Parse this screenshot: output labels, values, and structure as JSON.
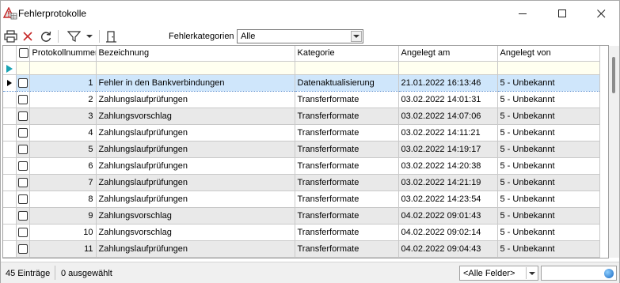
{
  "window": {
    "title": "Fehlerprotokolle",
    "minimize_glyph": "—",
    "maximize_glyph": "☐",
    "close_glyph": "✕"
  },
  "toolbar": {
    "filter_label": "Fehlerkategorien",
    "filter_value": "Alle",
    "icons": [
      "print-icon",
      "delete-icon",
      "refresh-icon",
      "filter-icon",
      "filter-dropdown-icon",
      "export-icon"
    ]
  },
  "grid": {
    "columns": [
      "Protokollnummer",
      "Bezeichnung",
      "Kategorie",
      "Angelegt am",
      "Angelegt von"
    ],
    "rows": [
      {
        "nr": "1",
        "bezeichnung": "Fehler in den Bankverbindungen",
        "kategorie": "Datenaktualisierung",
        "angelegt_am": "21.01.2022 16:13:46",
        "angelegt_von": "5 - Unbekannt"
      },
      {
        "nr": "2",
        "bezeichnung": "Zahlungslaufprüfungen",
        "kategorie": "Transferformate",
        "angelegt_am": "03.02.2022 14:01:31",
        "angelegt_von": "5 - Unbekannt"
      },
      {
        "nr": "3",
        "bezeichnung": "Zahlungsvorschlag",
        "kategorie": "Transferformate",
        "angelegt_am": "03.02.2022 14:07:06",
        "angelegt_von": "5 - Unbekannt"
      },
      {
        "nr": "4",
        "bezeichnung": "Zahlungslaufprüfungen",
        "kategorie": "Transferformate",
        "angelegt_am": "03.02.2022 14:11:21",
        "angelegt_von": "5 - Unbekannt"
      },
      {
        "nr": "5",
        "bezeichnung": "Zahlungslaufprüfungen",
        "kategorie": "Transferformate",
        "angelegt_am": "03.02.2022 14:19:17",
        "angelegt_von": "5 - Unbekannt"
      },
      {
        "nr": "6",
        "bezeichnung": "Zahlungslaufprüfungen",
        "kategorie": "Transferformate",
        "angelegt_am": "03.02.2022 14:20:38",
        "angelegt_von": "5 - Unbekannt"
      },
      {
        "nr": "7",
        "bezeichnung": "Zahlungslaufprüfungen",
        "kategorie": "Transferformate",
        "angelegt_am": "03.02.2022 14:21:19",
        "angelegt_von": "5 - Unbekannt"
      },
      {
        "nr": "8",
        "bezeichnung": "Zahlungslaufprüfungen",
        "kategorie": "Transferformate",
        "angelegt_am": "03.02.2022 14:23:54",
        "angelegt_von": "5 - Unbekannt"
      },
      {
        "nr": "9",
        "bezeichnung": "Zahlungsvorschlag",
        "kategorie": "Transferformate",
        "angelegt_am": "04.02.2022 09:01:43",
        "angelegt_von": "5 - Unbekannt"
      },
      {
        "nr": "10",
        "bezeichnung": "Zahlungsvorschlag",
        "kategorie": "Transferformate",
        "angelegt_am": "04.02.2022 09:02:14",
        "angelegt_von": "5 - Unbekannt"
      },
      {
        "nr": "11",
        "bezeichnung": "Zahlungslaufprüfungen",
        "kategorie": "Transferformate",
        "angelegt_am": "04.02.2022 09:04:43",
        "angelegt_von": "5 - Unbekannt"
      }
    ]
  },
  "statusbar": {
    "count": "45 Einträge",
    "selected": "0 ausgewählt",
    "field_filter": "<Alle Felder>"
  },
  "colors": {
    "selected_row": "#cfe6fb",
    "alt_row": "#e9e9e9",
    "filter_row": "#fffff0",
    "accent": "#1565c0"
  }
}
